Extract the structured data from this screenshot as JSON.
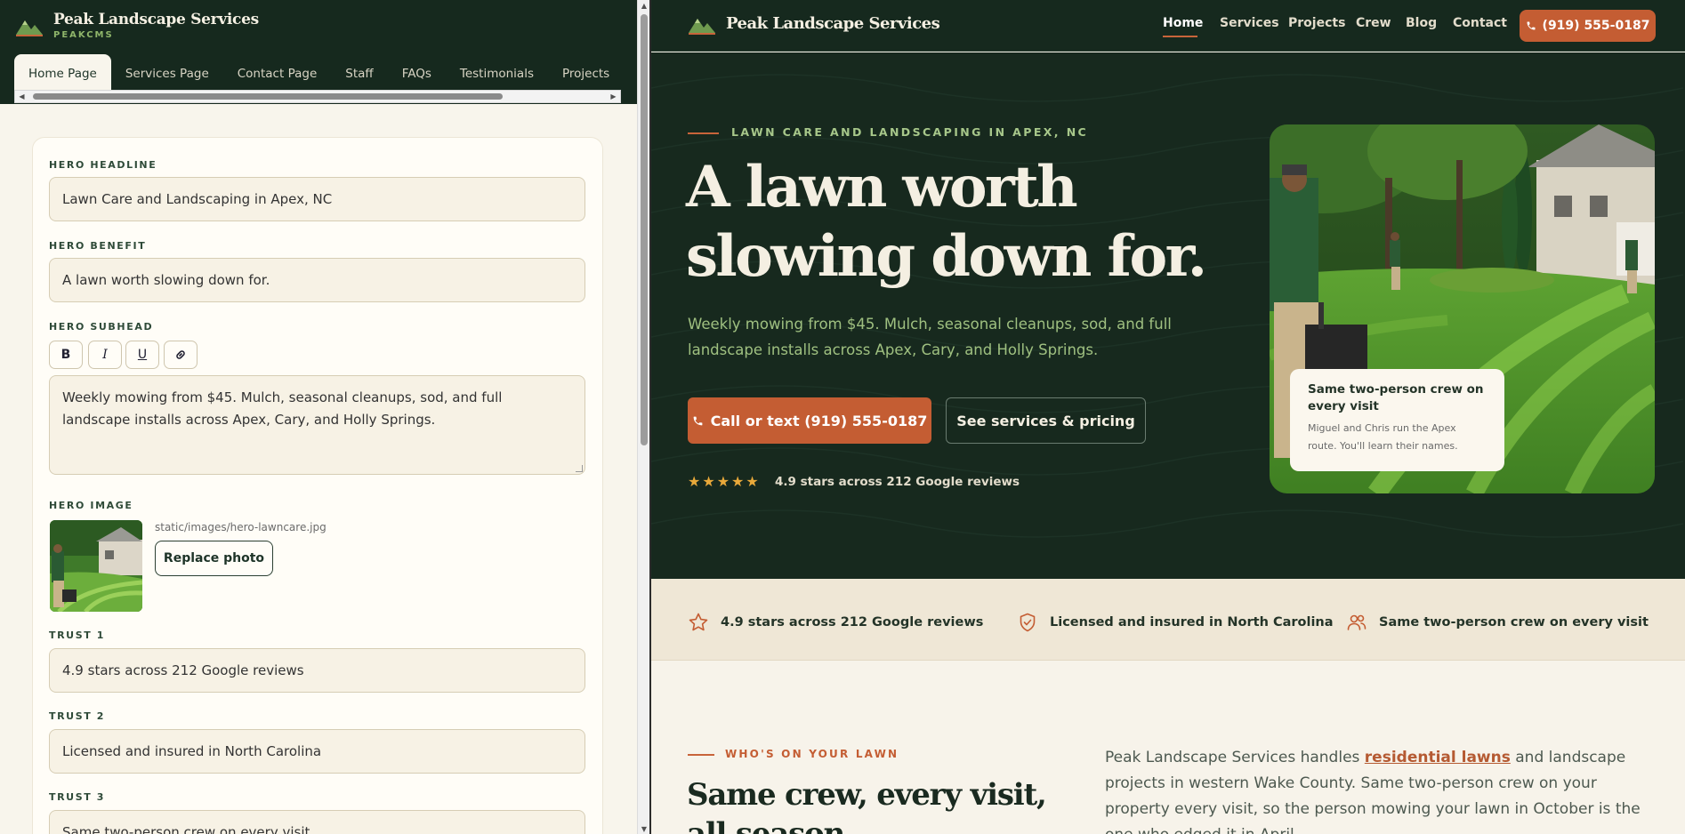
{
  "editor": {
    "brand": "Peak Landscape Services",
    "subbrand": "PEAKCMS",
    "tabs": [
      "Home Page",
      "Services Page",
      "Contact Page",
      "Staff",
      "FAQs",
      "Testimonials",
      "Projects"
    ],
    "active_tab": "Home Page",
    "fields": {
      "hero_headline": {
        "label": "HERO HEADLINE",
        "value": "Lawn Care and Landscaping in Apex, NC"
      },
      "hero_benefit": {
        "label": "HERO BENEFIT",
        "value": "A lawn worth slowing down for."
      },
      "hero_subhead": {
        "label": "HERO SUBHEAD",
        "value": "Weekly mowing from $45. Mulch, seasonal cleanups, sod, and full landscape installs across Apex, Cary, and Holly Springs."
      },
      "hero_image": {
        "label": "HERO IMAGE",
        "path": "static/images/hero-lawncare.jpg",
        "button": "Replace photo"
      },
      "trust_1": {
        "label": "TRUST 1",
        "value": "4.9 stars across 212 Google reviews"
      },
      "trust_2": {
        "label": "TRUST 2",
        "value": "Licensed and insured in North Carolina"
      },
      "trust_3": {
        "label": "TRUST 3",
        "value": "Same two-person crew on every visit"
      }
    },
    "format_buttons": {
      "bold": "B",
      "italic": "I",
      "underline": "U"
    }
  },
  "site": {
    "brand": "Peak Landscape Services",
    "nav": [
      "Home",
      "Services",
      "Projects",
      "Crew",
      "Blog",
      "Contact"
    ],
    "active_nav": "Home",
    "phone_button": "(919) 555-0187",
    "hero": {
      "eyebrow": "LAWN CARE AND LANDSCAPING IN APEX, NC",
      "headline": "A lawn worth slowing down for.",
      "subhead": "Weekly mowing from $45. Mulch, seasonal cleanups, sod, and full landscape installs across Apex, Cary, and Holly Springs.",
      "primary_button": "Call or text (919) 555-0187",
      "secondary_button": "See services & pricing",
      "stars": "★★★★★",
      "rating": "4.9 stars across 212 Google reviews",
      "photo_card_title": "Same two-person crew on every visit",
      "photo_card_desc": "Miguel and Chris run the Apex route. You'll learn their names."
    },
    "trust": [
      {
        "icon": "star-icon",
        "text": "4.9 stars across 212 Google reviews"
      },
      {
        "icon": "shield-check-icon",
        "text": "Licensed and insured in North Carolina"
      },
      {
        "icon": "users-icon",
        "text": "Same two-person crew on every visit"
      }
    ],
    "about": {
      "eyebrow": "WHO'S ON YOUR LAWN",
      "title": "Same crew, every visit, all season.",
      "body_prefix": "Peak Landscape Services handles ",
      "body_link": "residential lawns",
      "body_suffix": " and landscape projects in western Wake County. Same two-person crew on your property every visit, so the person mowing your lawn in October is the one who edged it in April."
    }
  },
  "colors": {
    "forest": "#16291e",
    "accent": "#c45d33",
    "cream": "#f7f3ea",
    "sage": "#9fc080"
  }
}
